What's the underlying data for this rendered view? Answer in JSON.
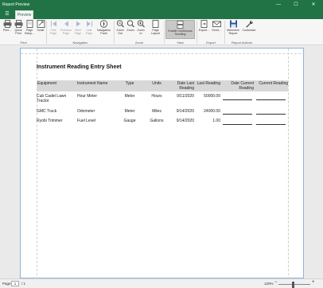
{
  "window": {
    "title": "Report Preview",
    "minimize": "—",
    "maximize": "☐",
    "close": "✕"
  },
  "ribbon": {
    "menu_glyph": "☰",
    "tab": "Preview",
    "buttons": {
      "print": "Print...",
      "quick_print": "Quick Print",
      "page_setup": "Page Setup...",
      "scale": "Scale",
      "first_page": "First Page",
      "previous_page": "Previous Page",
      "next_page": "Next Page",
      "last_page": "Last Page",
      "navigation_pane": "Navigation Pane",
      "zoom_out": "Zoom Out",
      "zoom": "Zoom",
      "zoom_in": "Zoom In",
      "page_layout": "Page Layout",
      "enable_continuous_scrolling": "Enable Continuous Scrolling",
      "export": "Export...",
      "send": "Send...",
      "memorize_report": "Memorize Report",
      "customize": "Customize"
    },
    "groups": {
      "print": "Print",
      "navigation": "Navigation",
      "zoom": "Zoom",
      "view": "View",
      "export": "Export",
      "report_actions": "Report Actions"
    }
  },
  "report": {
    "title": "Instrument Reading Entry Sheet",
    "columns": [
      "Equipment",
      "Instrument Name",
      "Type",
      "Units",
      "Date Last Reading",
      "Last Reading",
      "Date Current Reading",
      "Current Reading"
    ],
    "rows": [
      [
        "Cub Cadet Lawn Tractor",
        "Hour Meter",
        "Meter",
        "Hours",
        "9/11/2020",
        "50000.00"
      ],
      [
        "GMC Truck",
        "Odometer",
        "Meter",
        "Miles",
        "9/14/2020",
        "24000.00"
      ],
      [
        "Ryobi Trimmer",
        "Fuel Level",
        "Gauge",
        "Gallons",
        "9/14/2020",
        "1.00"
      ]
    ]
  },
  "status": {
    "page_label": "Page:",
    "page_value": "1",
    "page_of": "/ 1",
    "zoom_value": "120%",
    "zoom_fraction": 0.45,
    "zoom_minus": "−",
    "zoom_plus": "+"
  }
}
